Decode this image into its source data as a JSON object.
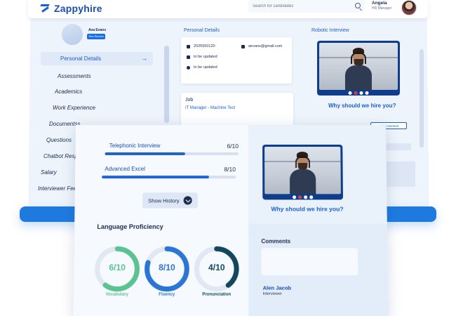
{
  "header": {
    "brand": "Zappyhire",
    "search_placeholder": "Search for candidates",
    "user_name": "Angela",
    "user_role": "HR Manager"
  },
  "profile": {
    "name": "Ava Evans",
    "view_button": "View Resume"
  },
  "sidebar": {
    "items": [
      {
        "label": "Personal Details"
      },
      {
        "label": "Assessments"
      },
      {
        "label": "Academics"
      },
      {
        "label": "Work Experience"
      },
      {
        "label": "Documentss"
      },
      {
        "label": "Questions"
      },
      {
        "label": "Chatbot Response"
      },
      {
        "label": "Salary"
      },
      {
        "label": "Interviewer Feedback"
      }
    ]
  },
  "personal_details": {
    "title": "Personal Details",
    "phone": "2025550120",
    "email": "aevans@gmail.com",
    "linkedin": "to be updated",
    "address": "to be updated"
  },
  "job": {
    "title": "Job",
    "role": "IT Manager - Machine Test"
  },
  "robotic_interview": {
    "title": "Robotic Interview",
    "question": "Why should we hire you?",
    "add_comment": "Add Comment"
  },
  "scores": [
    {
      "label": "Telephonic Interview",
      "value": "6/10",
      "fraction": 0.6
    },
    {
      "label": "Advanced Excel",
      "value": "8/10",
      "fraction": 0.8
    }
  ],
  "history_button": "Show History",
  "language_proficiency": {
    "title": "Language Proficiency",
    "rings": [
      {
        "label": "Vocabulary",
        "value": "6/10",
        "fraction": 0.6,
        "color": "#5bc391"
      },
      {
        "label": "Fluency",
        "value": "8/10",
        "fraction": 0.8,
        "color": "#2a76d2"
      },
      {
        "label": "Pronunciation",
        "value": "4/10",
        "fraction": 0.4,
        "color": "#12475e"
      }
    ]
  },
  "front_video": {
    "question": "Why should we hire you?"
  },
  "comments": {
    "title": "Comments",
    "value": "",
    "reviewer_name": "Alen Jacob",
    "reviewer_role": "Interviewer"
  }
}
